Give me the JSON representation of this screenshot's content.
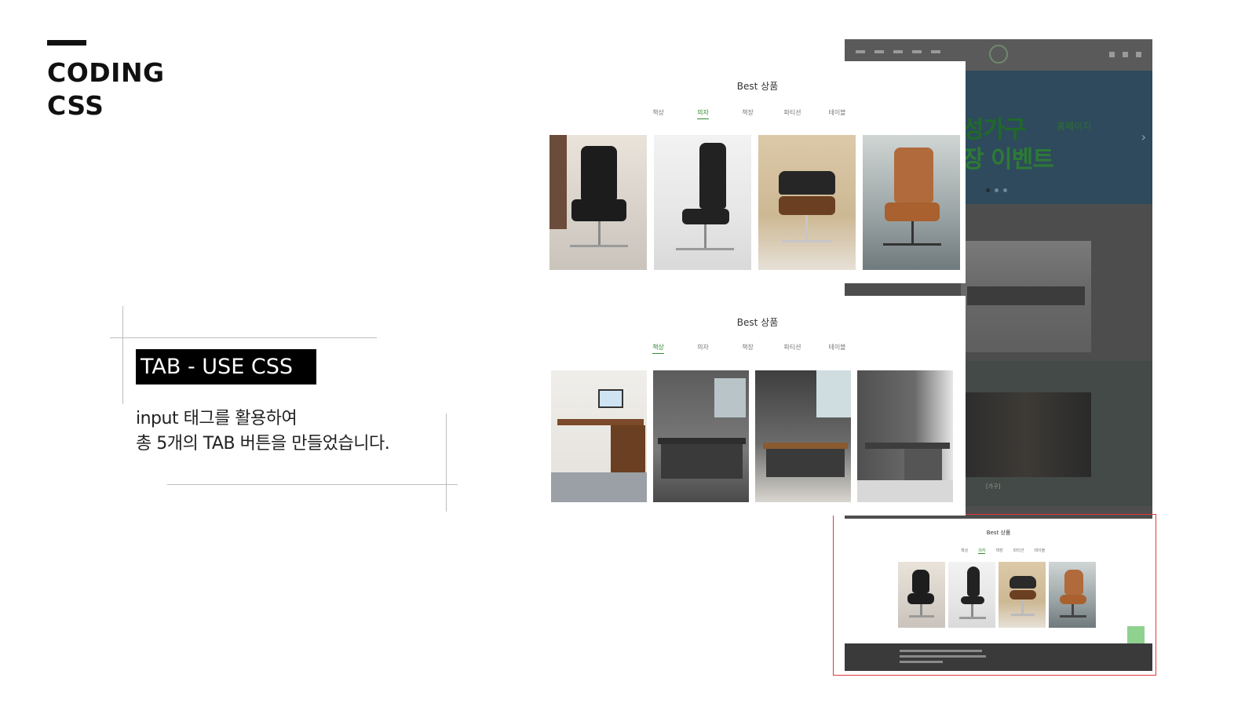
{
  "heading": {
    "line1": "CODING",
    "line2": "CSS"
  },
  "tab_label": "TAB - USE CSS",
  "description": {
    "line1": "input 태그를 활용하여",
    "line2": "총 5개의 TAB 버튼을 만들었습니다."
  },
  "panels": [
    {
      "title": "Best 상품",
      "tabs": [
        "책상",
        "의자",
        "책장",
        "파티션",
        "테이블"
      ],
      "active_tab": 1,
      "products": [
        "chair-1",
        "chair-2",
        "chair-3",
        "chair-4"
      ]
    },
    {
      "title": "Best 상품",
      "tabs": [
        "책상",
        "의자",
        "책장",
        "파티션",
        "테이블"
      ],
      "active_tab": 0,
      "products": [
        "desk-1",
        "desk-2",
        "desk-3",
        "desk-4"
      ]
    }
  ],
  "background_site": {
    "hero_line1": "성가구",
    "hero_line1_small": "홈페이지",
    "hero_line2": "장 이벤트",
    "section2_caption": "[가구]",
    "bottom_title": "Best 상품",
    "bottom_tabs": [
      "책상",
      "의자",
      "책장",
      "파티션",
      "테이블"
    ],
    "bottom_active_tab": 1
  },
  "colors": {
    "accent": "#2e8b2e",
    "highlight_border": "#e03a3a",
    "tab_label_bg": "#000000"
  }
}
